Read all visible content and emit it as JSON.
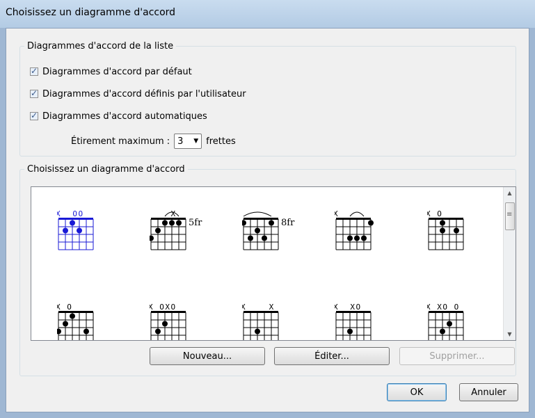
{
  "window": {
    "title": "Choisissez un diagramme d'accord"
  },
  "list_group": {
    "legend": "Diagrammes d'accord de la liste",
    "options": [
      {
        "label": "Diagrammes d'accord par défaut",
        "checked": true
      },
      {
        "label": "Diagrammes d'accord définis par l'utilisateur",
        "checked": true
      },
      {
        "label": "Diagrammes d'accord automatiques",
        "checked": true
      }
    ],
    "stretch_label": "Étirement  maximum :",
    "stretch_value": "3",
    "stretch_unit": "frettes"
  },
  "choose_group": {
    "legend": "Choisissez un diagramme d'accord"
  },
  "chords": [
    {
      "markers": "X  OO",
      "fret_label": "",
      "selected": true
    },
    {
      "markers": "    X",
      "fret_label": "5fr",
      "selected": false
    },
    {
      "markers": "",
      "fret_label": "8fr",
      "selected": false
    },
    {
      "markers": "X",
      "fret_label": "",
      "selected": false
    },
    {
      "markers": "X O",
      "fret_label": "",
      "selected": false
    },
    {
      "markers": "X O",
      "fret_label": "",
      "selected": false
    },
    {
      "markers": "X OXO",
      "fret_label": "",
      "selected": false
    },
    {
      "markers": "X    X",
      "fret_label": "",
      "selected": false
    },
    {
      "markers": "X  XO",
      "fret_label": "",
      "selected": false
    },
    {
      "markers": "X XO O",
      "fret_label": "",
      "selected": false
    }
  ],
  "buttons": {
    "new": "Nouveau...",
    "edit": "Éditer...",
    "delete": "Supprimer...",
    "ok": "OK",
    "cancel": "Annuler"
  },
  "colors": {
    "selected_chord": "#1a1ad6",
    "chord": "#000000"
  }
}
